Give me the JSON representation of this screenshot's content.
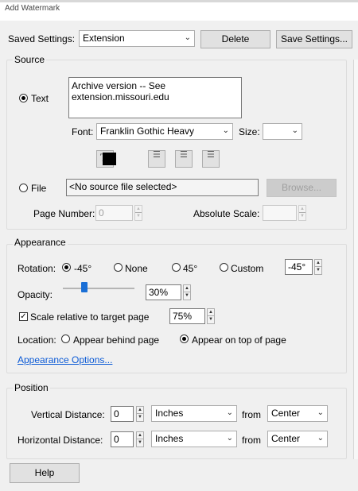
{
  "window": {
    "title": "Add Watermark"
  },
  "saved_settings": {
    "label": "Saved Settings:",
    "value": "Extension",
    "delete_label": "Delete",
    "save_label": "Save Settings..."
  },
  "source": {
    "group_label": "Source",
    "text_radio_label": "Text",
    "text_value": "Archive version -- See\nextension.missouri.edu",
    "font_label": "Font:",
    "font_value": "Franklin Gothic Heavy",
    "size_label": "Size:",
    "size_value": "",
    "text_color": "#000000",
    "file_radio_label": "File",
    "file_value": "<No source file selected>",
    "browse_label": "Browse...",
    "page_number_label": "Page Number:",
    "page_number_value": "0",
    "absolute_scale_label": "Absolute Scale:",
    "absolute_scale_value": ""
  },
  "appearance": {
    "group_label": "Appearance",
    "rotation_label": "Rotation:",
    "rotation_options": [
      "-45°",
      "None",
      "45°",
      "Custom"
    ],
    "rotation_selected": "-45°",
    "custom_rotation_value": "-45°",
    "opacity_label": "Opacity:",
    "opacity_value": "30%",
    "opacity_fraction": 0.3,
    "scale_label": "Scale relative to target page",
    "scale_checked": true,
    "scale_value": "75%",
    "location_label": "Location:",
    "location_behind_label": "Appear behind page",
    "location_top_label": "Appear on top of page",
    "location_selected": "Appear on top of page",
    "options_link": "Appearance Options..."
  },
  "position": {
    "group_label": "Position",
    "vertical_label": "Vertical Distance:",
    "vertical_value": "0",
    "vertical_unit": "Inches",
    "vertical_from_label": "from",
    "vertical_from_value": "Center",
    "horizontal_label": "Horizontal Distance:",
    "horizontal_value": "0",
    "horizontal_unit": "Inches",
    "horizontal_from_label": "from",
    "horizontal_from_value": "Center"
  },
  "footer": {
    "help_label": "Help"
  },
  "colors": {
    "accent": "#0b5ad6",
    "slider_thumb": "#1a6fd6"
  }
}
